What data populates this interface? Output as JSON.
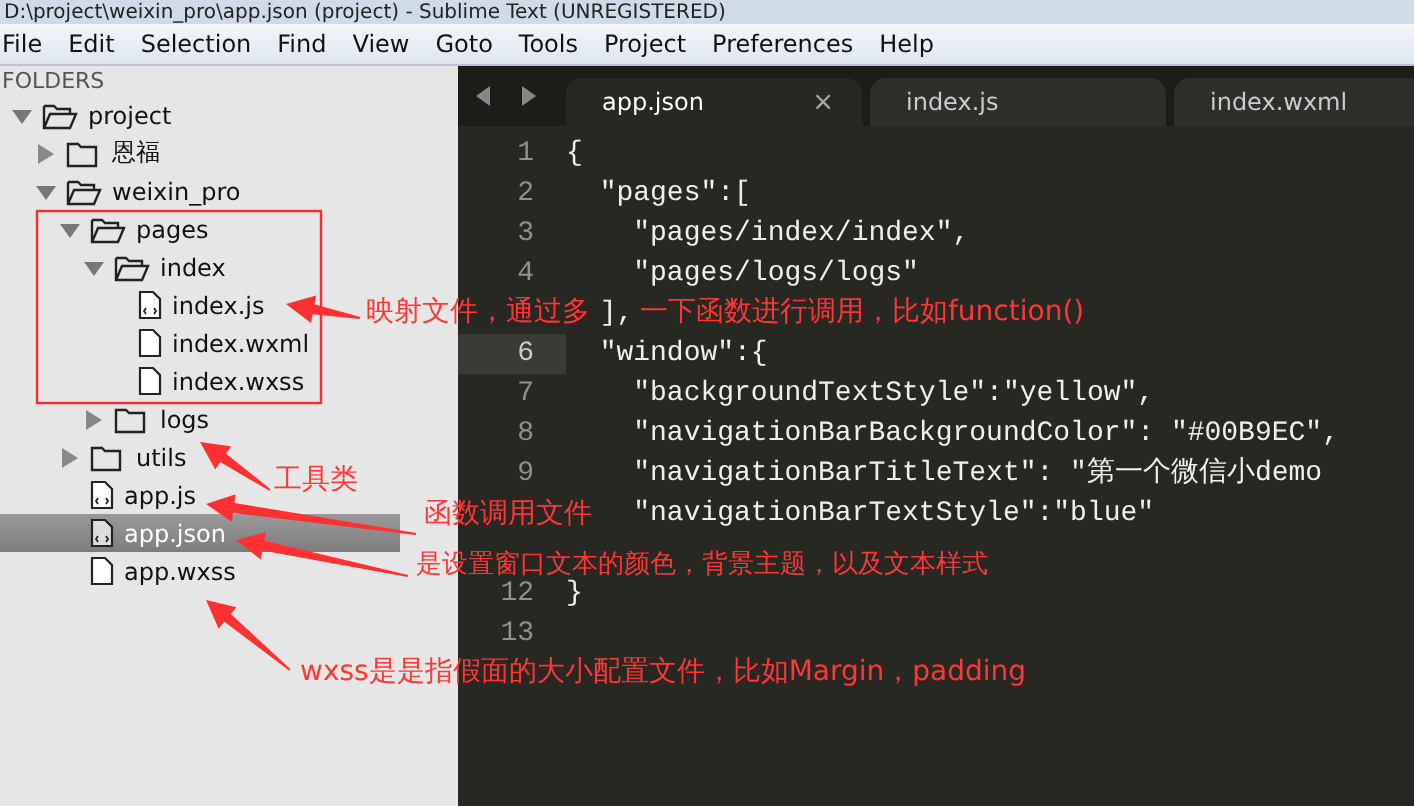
{
  "window": {
    "title": "D:\\project\\weixin_pro\\app.json (project) - Sublime Text (UNREGISTERED)"
  },
  "menu": [
    "File",
    "Edit",
    "Selection",
    "Find",
    "View",
    "Goto",
    "Tools",
    "Project",
    "Preferences",
    "Help"
  ],
  "sidebar": {
    "header": "FOLDERS",
    "tree": [
      {
        "label": "project",
        "kind": "folder",
        "expanded": true,
        "selected": false,
        "children": [
          {
            "label": "恩福",
            "kind": "folder",
            "expanded": false,
            "selected": false
          },
          {
            "label": "weixin_pro",
            "kind": "folder",
            "expanded": true,
            "selected": false,
            "children": [
              {
                "label": "pages",
                "kind": "folder",
                "expanded": true,
                "selected": false,
                "children": [
                  {
                    "label": "index",
                    "kind": "folder",
                    "expanded": true,
                    "selected": false,
                    "children": [
                      {
                        "label": "index.js",
                        "kind": "code-file",
                        "selected": false
                      },
                      {
                        "label": "index.wxml",
                        "kind": "file",
                        "selected": false
                      },
                      {
                        "label": "index.wxss",
                        "kind": "file",
                        "selected": false
                      }
                    ]
                  },
                  {
                    "label": "logs",
                    "kind": "folder",
                    "expanded": false,
                    "selected": false
                  }
                ]
              },
              {
                "label": "utils",
                "kind": "folder",
                "expanded": false,
                "selected": false
              },
              {
                "label": "app.js",
                "kind": "code-file",
                "selected": false
              },
              {
                "label": "app.json",
                "kind": "code-file",
                "selected": true
              },
              {
                "label": "app.wxss",
                "kind": "file",
                "selected": false
              }
            ]
          }
        ]
      }
    ]
  },
  "tabs": [
    {
      "label": "app.json",
      "selected": true,
      "close": "×"
    },
    {
      "label": "index.js",
      "selected": false
    },
    {
      "label": "index.wxml",
      "selected": false
    }
  ],
  "editor": {
    "lines": [
      {
        "number": "1",
        "text": "{",
        "current": false
      },
      {
        "number": "2",
        "text": "  \"pages\":[",
        "current": false
      },
      {
        "number": "3",
        "text": "    \"pages/index/index\",",
        "current": false
      },
      {
        "number": "4",
        "text": "    \"pages/logs/logs\"",
        "current": false
      },
      {
        "text": "  ],",
        "current": false
      },
      {
        "number": "6",
        "text": "  \"window\":{",
        "current": true
      },
      {
        "number": "7",
        "text": "    \"backgroundTextStyle\":\"yellow\",",
        "current": false
      },
      {
        "number": "8",
        "text": "    \"navigationBarBackgroundColor\": \"#00B9EC\",",
        "current": false
      },
      {
        "number": "9",
        "text": "    \"navigationBarTitleText\": \"第一个微信小demo",
        "current": false
      },
      {
        "text": "    \"navigationBarTextStyle\":\"blue\"",
        "current": false
      },
      {
        "current": false
      },
      {
        "number": "12",
        "text": "}",
        "current": false
      },
      {
        "number": "13",
        "current": false
      }
    ]
  },
  "annotations": [
    {
      "text": "映射文件，通过多"
    },
    {
      "text": "一下函数进行调用，比如function()"
    },
    {
      "text": "工具类"
    },
    {
      "text": "函数调用文件"
    },
    {
      "text": "是设置窗口文本的颜色，背景主题，以及文本样式"
    },
    {
      "text": "wxss是是指假面的大小配置文件，比如Margin，padding"
    }
  ]
}
